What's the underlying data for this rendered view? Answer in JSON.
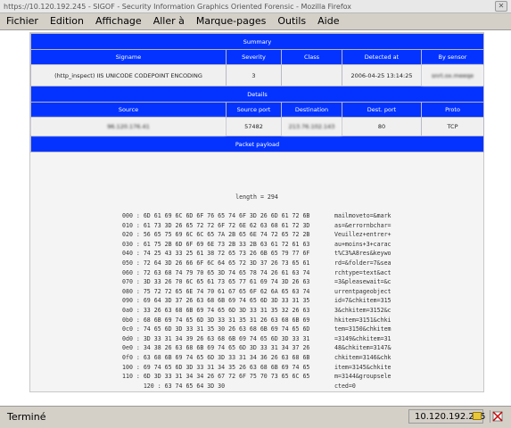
{
  "window": {
    "title": "https://10.120.192.245 - SIGOF - Security Information Graphics Oriented Forensic - Mozilla Firefox",
    "close_glyph": "✕"
  },
  "menu": [
    "Fichier",
    "Edition",
    "Affichage",
    "Aller à",
    "Marque-pages",
    "Outils",
    "Aide"
  ],
  "summary": {
    "title": "Summary",
    "headers": [
      "Signame",
      "Severity",
      "Class",
      "Detected at",
      "By sensor"
    ],
    "row": {
      "signame": "(http_inspect) IIS UNICODE CODEPOINT ENCODING",
      "severity": "3",
      "class": "",
      "detected_at": "2006-04-25 13:14:25",
      "by_sensor": "snrt.ox.meeqe"
    }
  },
  "details": {
    "title": "Details",
    "headers": [
      "Source",
      "Source port",
      "Destination",
      "Dest. port",
      "Proto"
    ],
    "row": {
      "source": "96.120.176.41",
      "source_port": "57482",
      "destination": "213.76.102.143",
      "dest_port": "80",
      "proto": "TCP"
    }
  },
  "payload": {
    "title": "Packet payload",
    "length_label": "length = 294",
    "hex_lines": [
      "000 : 6D 61 69 6C 6D 6F 76 65 74 6F 3D 26 6D 61 72 6B",
      "010 : 61 73 3D 26 65 72 72 6F 72 6E 62 63 68 61 72 3D",
      "020 : 56 65 75 69 6C 6C 65 7A 2B 65 6E 74 72 65 72 2B",
      "030 : 61 75 2B 6D 6F 69 6E 73 2B 33 2B 63 61 72 61 63",
      "040 : 74 25 43 33 25 61 38 72 65 73 26 6B 65 79 77 6F",
      "050 : 72 64 3D 26 66 6F 6C 64 65 72 3D 37 26 73 65 61",
      "060 : 72 63 68 74 79 70 65 3D 74 65 78 74 26 61 63 74",
      "070 : 3D 33 26 70 6C 65 61 73 65 77 61 69 74 3D 26 63",
      "080 : 75 72 72 65 6E 74 70 61 67 65 6F 62 6A 65 63 74",
      "090 : 69 64 3D 37 26 63 68 6B 69 74 65 6D 3D 33 31 35",
      "0a0 : 33 26 63 68 6B 69 74 65 6D 3D 33 31 35 32 26 63",
      "0b0 : 68 6B 69 74 65 6D 3D 33 31 35 31 26 63 68 6B 69",
      "0c0 : 74 65 6D 3D 33 31 35 30 26 63 68 6B 69 74 65 6D",
      "0d0 : 3D 33 31 34 39 26 63 68 6B 69 74 65 6D 3D 33 31",
      "0e0 : 34 38 26 63 68 6B 69 74 65 6D 3D 33 31 34 37 26",
      "0f0 : 63 68 6B 69 74 65 6D 3D 33 31 34 36 26 63 68 6B",
      "100 : 69 74 65 6D 3D 33 31 34 35 26 63 68 6B 69 74 65",
      "110 : 6D 3D 33 31 34 34 26 67 72 6F 75 70 73 65 6C 65",
      "      120 : 63 74 65 64 3D 30"
    ],
    "ascii_lines": [
      "mailmoveto=&mark",
      "as=&errornbchar=",
      "Veuillez+entrer+",
      "au+moins+3+carac",
      "t%C3%A8res&keywo",
      "rd=&folder=7&sea",
      "rchtype=text&act",
      "=3&pleasewait=&c",
      "urrentpageobject",
      "id=7&chkitem=315",
      "3&chkitem=3152&c",
      "hkitem=3151&chki",
      "tem=3150&chkitem",
      "=3149&chkitem=31",
      "48&chkitem=3147&",
      "chkitem=3146&chk",
      "item=3145&chkite",
      "m=3144&groupsele",
      "cted=0"
    ]
  },
  "status": {
    "text": "Terminé",
    "host": "10.120.192.245"
  },
  "colors": {
    "section_blue": "#0433ff",
    "chrome_gray": "#d4d0c8"
  }
}
